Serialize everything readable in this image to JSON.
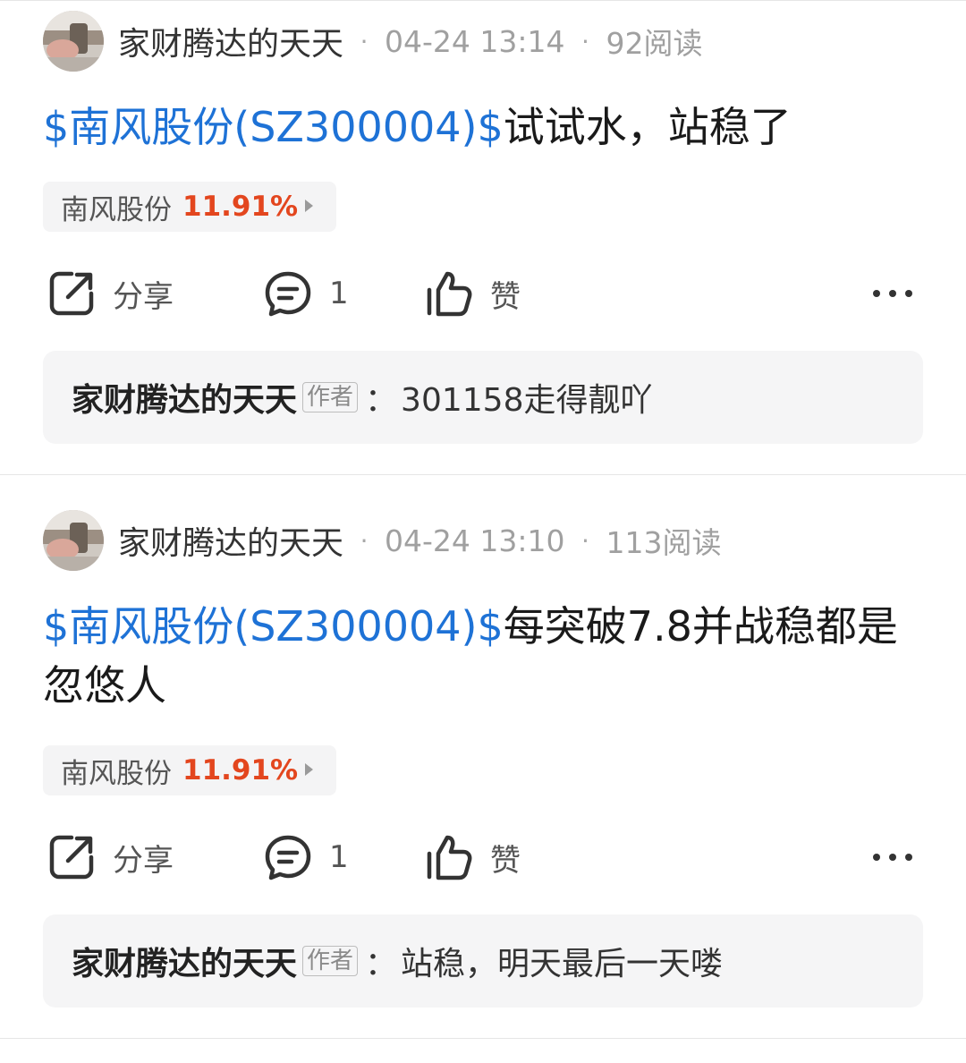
{
  "posts": [
    {
      "author": "家财腾达的天天",
      "date": "04-24 13:14",
      "reads": "92阅读",
      "stock_tag": "$南风股份(SZ300004)$",
      "text": "试试水，站稳了",
      "chip": {
        "name": "南风股份",
        "change": "11.91%"
      },
      "actions": {
        "share": "分享",
        "comments": "1",
        "like": "赞"
      },
      "reply": {
        "author": "家财腾达的天天",
        "badge": "作者",
        "colon": "：",
        "text": "301158走得靓吖"
      }
    },
    {
      "author": "家财腾达的天天",
      "date": "04-24 13:10",
      "reads": "113阅读",
      "stock_tag": "$南风股份(SZ300004)$",
      "text": "每突破7.8并战稳都是忽悠人",
      "chip": {
        "name": "南风股份",
        "change": "11.91%"
      },
      "actions": {
        "share": "分享",
        "comments": "1",
        "like": "赞"
      },
      "reply": {
        "author": "家财腾达的天天",
        "badge": "作者",
        "colon": "：",
        "text": "站稳，明天最后一天喽"
      }
    }
  ],
  "meta_separator": "·",
  "colors": {
    "link": "#1e72d6",
    "up": "#e3461e",
    "muted": "#a0a0a0"
  },
  "icons": [
    "share-icon",
    "comment-icon",
    "thumbs-up-icon",
    "more-icon",
    "chevron-right-icon"
  ]
}
